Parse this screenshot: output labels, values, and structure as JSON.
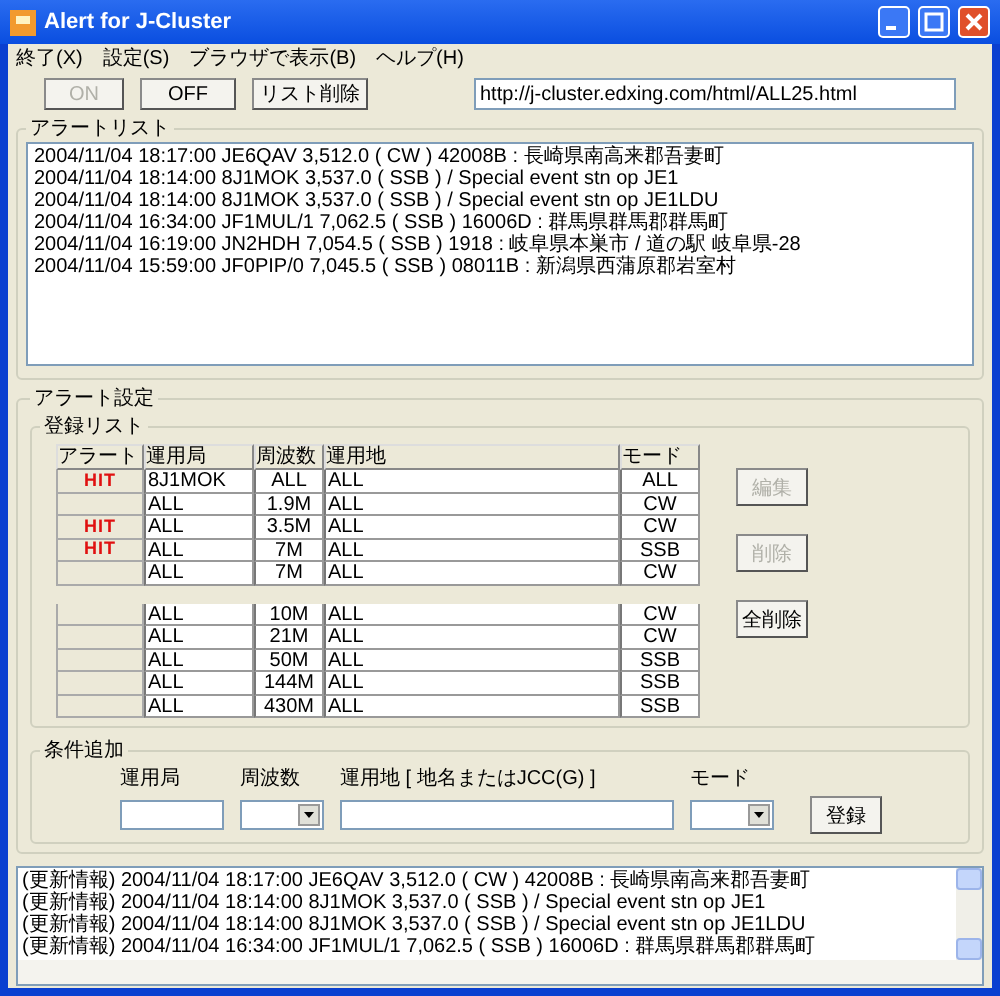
{
  "window": {
    "title": "Alert for J-Cluster"
  },
  "menu": [
    "終了(X)",
    "設定(S)",
    "ブラウザで表示(B)",
    "ヘルプ(H)"
  ],
  "toolbar": {
    "buttons": [
      {
        "label": "ON",
        "disabled": true
      },
      {
        "label": "OFF",
        "disabled": false
      },
      {
        "label": "リスト削除",
        "disabled": false
      }
    ],
    "url": "http://j-cluster.edxing.com/html/ALL25.html"
  },
  "alert_list": {
    "title": "アラートリスト",
    "lines": [
      "2004/11/04  18:17:00  JE6QAV  3,512.0 ( CW )  42008B : 長崎県南高来郡吾妻町",
      "2004/11/04  18:14:00  8J1MOK  3,537.0 ( SSB )   / Special event stn op JE1",
      "2004/11/04  18:14:00  8J1MOK  3,537.0 ( SSB )   / Special event stn op JE1LDU",
      "2004/11/04  16:34:00  JF1MUL/1  7,062.5 ( SSB )  16006D : 群馬県群馬郡群馬町",
      "2004/11/04  16:19:00  JN2HDH  7,054.5 ( SSB )  1918 : 岐阜県本巣市 / 道の駅 岐阜県-28",
      "2004/11/04  15:59:00  JF0PIP/0  7,045.5 ( SSB )  08011B : 新潟県西蒲原郡岩室村"
    ]
  },
  "alert_settings": {
    "title": "アラート設定",
    "registration_list": {
      "title": "登録リスト",
      "columns": [
        "アラート",
        "運用局",
        "周波数",
        "運用地",
        "モード"
      ],
      "groups": [
        [
          {
            "alert": "HIT",
            "station": "8J1MOK",
            "freq": "ALL",
            "location": "ALL",
            "mode": "ALL"
          },
          {
            "station": "ALL",
            "freq": "1.9M",
            "location": "ALL",
            "mode": "CW"
          },
          {
            "alert": "HIT",
            "station": "ALL",
            "freq": "3.5M",
            "location": "ALL",
            "mode": "CW"
          },
          {
            "alert": "HIT",
            "station": "ALL",
            "freq": "7M",
            "location": "ALL",
            "mode": "SSB"
          },
          {
            "station": "ALL",
            "freq": "7M",
            "location": "ALL",
            "mode": "CW"
          }
        ],
        [
          {
            "station": "ALL",
            "freq": "10M",
            "location": "ALL",
            "mode": "CW"
          },
          {
            "station": "ALL",
            "freq": "21M",
            "location": "ALL",
            "mode": "CW"
          },
          {
            "station": "ALL",
            "freq": "50M",
            "location": "ALL",
            "mode": "SSB"
          },
          {
            "station": "ALL",
            "freq": "144M",
            "location": "ALL",
            "mode": "SSB"
          },
          {
            "station": "ALL",
            "freq": "430M",
            "location": "ALL",
            "mode": "SSB"
          }
        ]
      ],
      "buttons": [
        {
          "label": "編集",
          "disabled": true
        },
        {
          "label": "削除",
          "disabled": true
        },
        {
          "label": "全削除",
          "disabled": false
        }
      ]
    },
    "condition_add": {
      "title": "条件追加",
      "fields": [
        {
          "label": "運用局",
          "kind": "text"
        },
        {
          "label": "周波数",
          "kind": "select"
        },
        {
          "label": "運用地 [ 地名またはJCC(G) ]",
          "kind": "text"
        },
        {
          "label": "モード",
          "kind": "select"
        }
      ],
      "button": "登録"
    }
  },
  "log": [
    "(更新情報) 2004/11/04  18:17:00  JE6QAV  3,512.0 ( CW )  42008B : 長崎県南高来郡吾妻町",
    "(更新情報) 2004/11/04  18:14:00  8J1MOK  3,537.0 ( SSB )   / Special event stn op JE1",
    "(更新情報) 2004/11/04  18:14:00  8J1MOK  3,537.0 ( SSB )   / Special event stn op JE1LDU",
    "(更新情報) 2004/11/04  16:34:00  JF1MUL/1  7,062.5 ( SSB )  16006D : 群馬県群馬郡群馬町"
  ]
}
